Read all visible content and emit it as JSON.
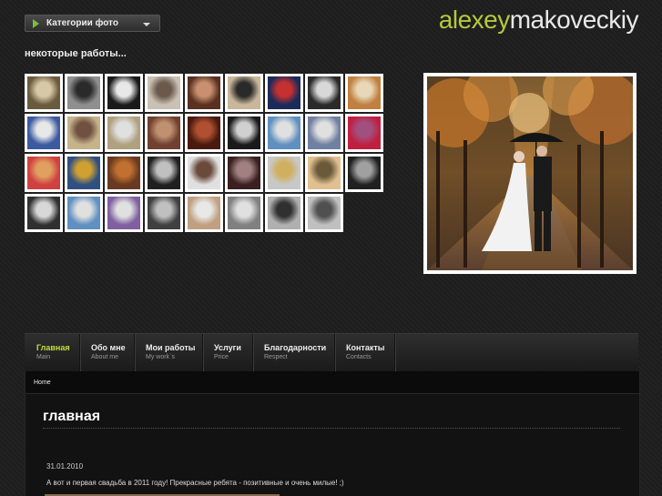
{
  "category_menu": {
    "label": "Категории фото"
  },
  "logo": {
    "part1": "alexey",
    "part2": "makoveckiy"
  },
  "works_title": "некоторые работы...",
  "thumbnails": [
    [
      "#6a5a3e",
      "#d7c9a8"
    ],
    [
      "#8f8f8f",
      "#2a2a2a"
    ],
    [
      "#1a1a1a",
      "#e8e8e8"
    ],
    [
      "#c9c1b4",
      "#6b5a4c"
    ],
    [
      "#5a3020",
      "#c89070"
    ],
    [
      "#c9b79c",
      "#2a2a2a"
    ],
    [
      "#1c2a5a",
      "#c53030"
    ],
    [
      "#2a2a2a",
      "#d8d8d8"
    ],
    [
      "#c08040",
      "#e8d8b8"
    ],
    [
      "#3b5aa0",
      "#e8e8e8"
    ],
    [
      "#c5b38a",
      "#705040"
    ],
    [
      "#b0a080",
      "#e0e0e0"
    ],
    [
      "#704030",
      "#c09070"
    ],
    [
      "#4a1a10",
      "#b05030"
    ],
    [
      "#1a1a1a",
      "#d0d0d0"
    ],
    [
      "#6090c0",
      "#e0e0e0"
    ],
    [
      "#7080a0",
      "#e0e0e0"
    ],
    [
      "#c02040",
      "#a05080"
    ],
    [
      "#d04040",
      "#e0a060"
    ],
    [
      "#305080",
      "#d0a030"
    ],
    [
      "#6a3a20",
      "#c07030"
    ],
    [
      "#202020",
      "#c0c0c0"
    ],
    [
      "#e0e0e0",
      "#6a4a3a"
    ],
    [
      "#3a2020",
      "#a08080"
    ],
    [
      "#c8c8c8",
      "#d0b060"
    ],
    [
      "#e0c090",
      "#6a5a3a"
    ],
    [
      "#202020",
      "#a0a0a0"
    ],
    [
      "#303030",
      "#d8d8d8"
    ],
    [
      "#6090c0",
      "#e0e0e0"
    ],
    [
      "#8060a0",
      "#e0e0e0"
    ],
    [
      "#404040",
      "#c0c0c0"
    ],
    [
      "#c0a080",
      "#e8e8e8"
    ],
    [
      "#808080",
      "#e0e0e0"
    ],
    [
      "#b0b0b0",
      "#303030"
    ],
    [
      "#c0c0c0",
      "#505050"
    ]
  ],
  "featured_photo": {
    "description": "wedding couple under umbrella in autumn alley"
  },
  "nav": [
    {
      "ru": "Главная",
      "en": "Main"
    },
    {
      "ru": "Обо мне",
      "en": "About me"
    },
    {
      "ru": "Мои работы",
      "en": "My work`s"
    },
    {
      "ru": "Услуги",
      "en": "Price"
    },
    {
      "ru": "Благодарности",
      "en": "Respect"
    },
    {
      "ru": "Контакты",
      "en": "Contacts"
    }
  ],
  "breadcrumb": "Home",
  "page_title": "главная",
  "post": {
    "date": "31.01.2010",
    "text": "А вот и первая свадьба в 2011 году! Прекрасные ребята - позитивные и очень милые! ;)"
  },
  "colors": {
    "accent": "#b6c93a",
    "active_nav": "#c8dc3c",
    "background": "#1e1e1e"
  }
}
